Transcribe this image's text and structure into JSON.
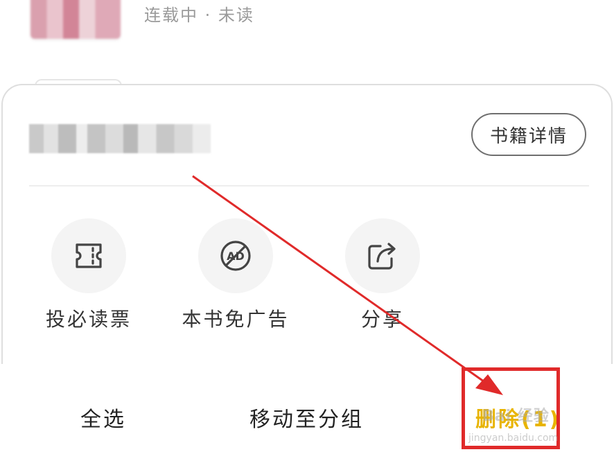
{
  "book_list": {
    "status_text": "连载中 · 未读"
  },
  "sheet": {
    "detail_button_label": "书籍详情",
    "actions": [
      {
        "label": "投必读票",
        "icon": "ticket-icon"
      },
      {
        "label": "本书免广告",
        "icon": "no-ad-icon",
        "icon_text": "AD"
      },
      {
        "label": "分享",
        "icon": "share-icon"
      }
    ]
  },
  "toolbar": {
    "select_all_label": "全选",
    "move_label": "移动至分组",
    "delete_label": "删除(1)"
  },
  "watermark": {
    "brand": "Bai 经验",
    "url": "jingyan.baidu.com"
  },
  "colors": {
    "delete_accent": "#e8b400",
    "annotation_red": "#e02a2a"
  }
}
